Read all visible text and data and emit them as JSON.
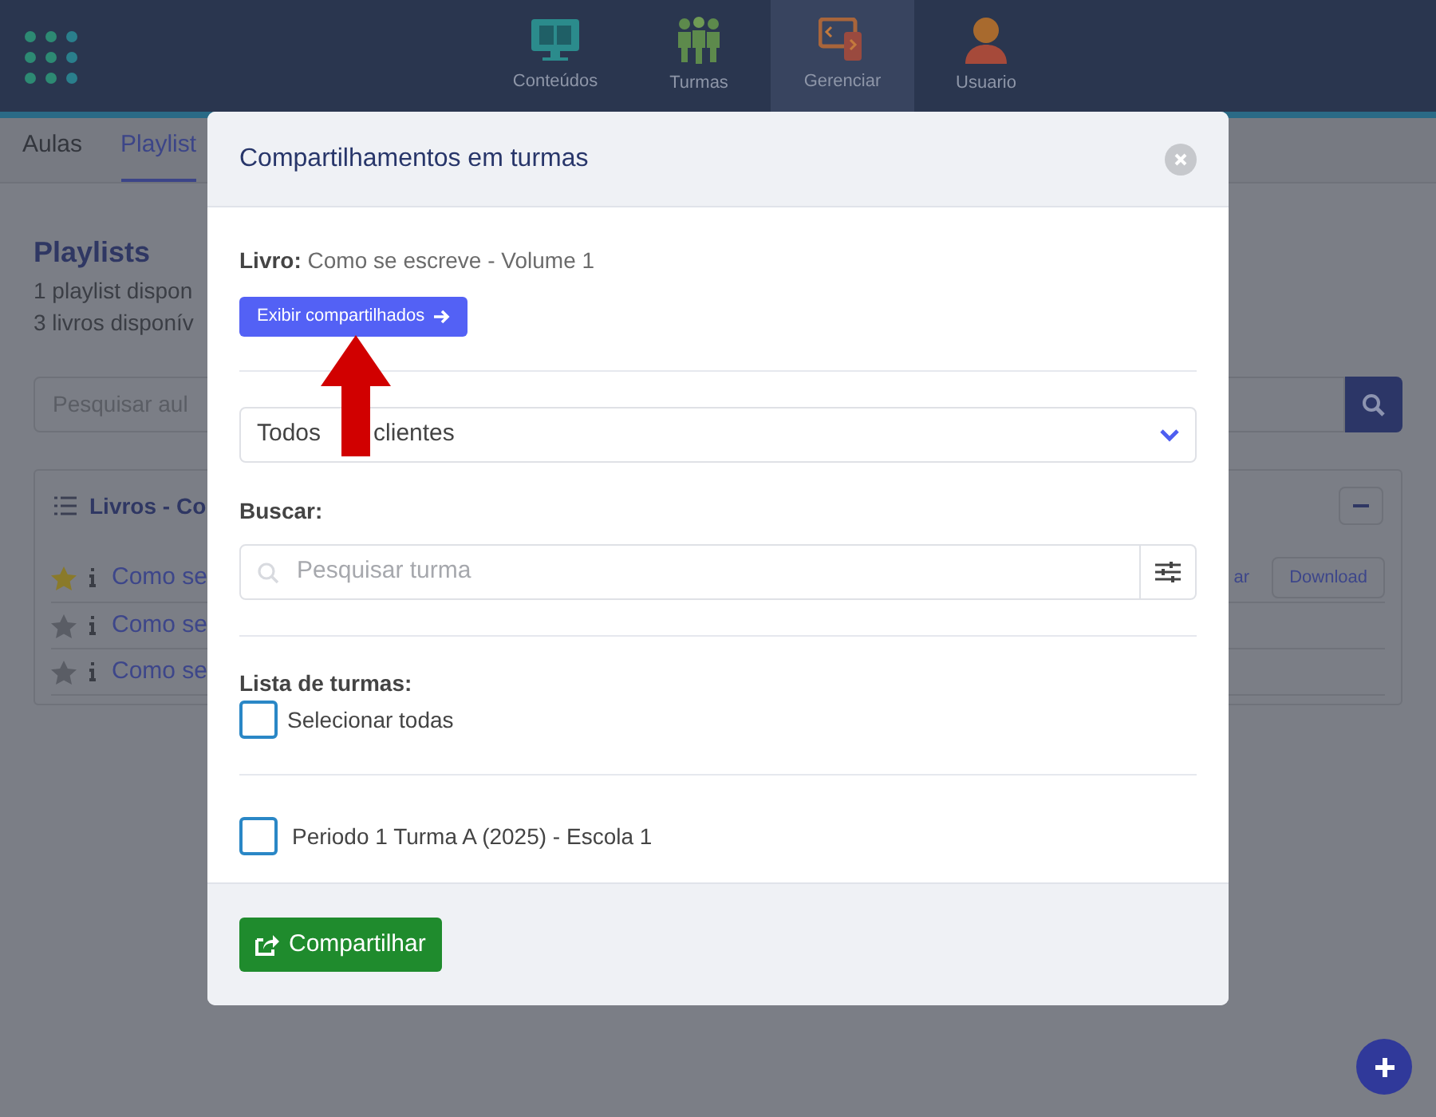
{
  "app_header": {
    "nav": [
      {
        "label": "Conteúdos",
        "kind": "monitor",
        "selected": false
      },
      {
        "label": "Turmas",
        "kind": "people",
        "selected": false
      },
      {
        "label": "Gerenciar",
        "kind": "devices",
        "selected": true
      },
      {
        "label": "Usuario",
        "kind": "user",
        "selected": false
      }
    ]
  },
  "tabs": [
    {
      "label": "Aulas",
      "selected": false
    },
    {
      "label": "Playlist",
      "selected": true
    }
  ],
  "page": {
    "title": "Playlists",
    "lines": [
      "1 playlist dispon",
      "3 livros disponív"
    ],
    "search": {
      "placeholder": "Pesquisar aul"
    },
    "card": {
      "title": "Livros - Co",
      "rows": [
        {
          "title": "Como se",
          "favorite": true,
          "actions": [
            "ar",
            "Download"
          ]
        },
        {
          "title": "Como se",
          "favorite": false
        },
        {
          "title": "Como se",
          "favorite": false
        }
      ]
    }
  },
  "modal": {
    "title": "Compartilhamentos em turmas",
    "book_label": "Livro:",
    "book_title": "Como se escreve - Volume 1",
    "show_button": "Exibir compartilhados",
    "client_select": {
      "value_parts": [
        "Todos",
        "clientes"
      ]
    },
    "search_label": "Buscar:",
    "search": {
      "placeholder": "Pesquisar turma"
    },
    "list_label": "Lista de turmas:",
    "select_all": {
      "label": "Selecionar todas",
      "checked": false
    },
    "classes": [
      {
        "label": "Periodo 1 Turma A (2025) - Escola 1",
        "checked": false
      }
    ],
    "submit": "Compartilhar"
  }
}
